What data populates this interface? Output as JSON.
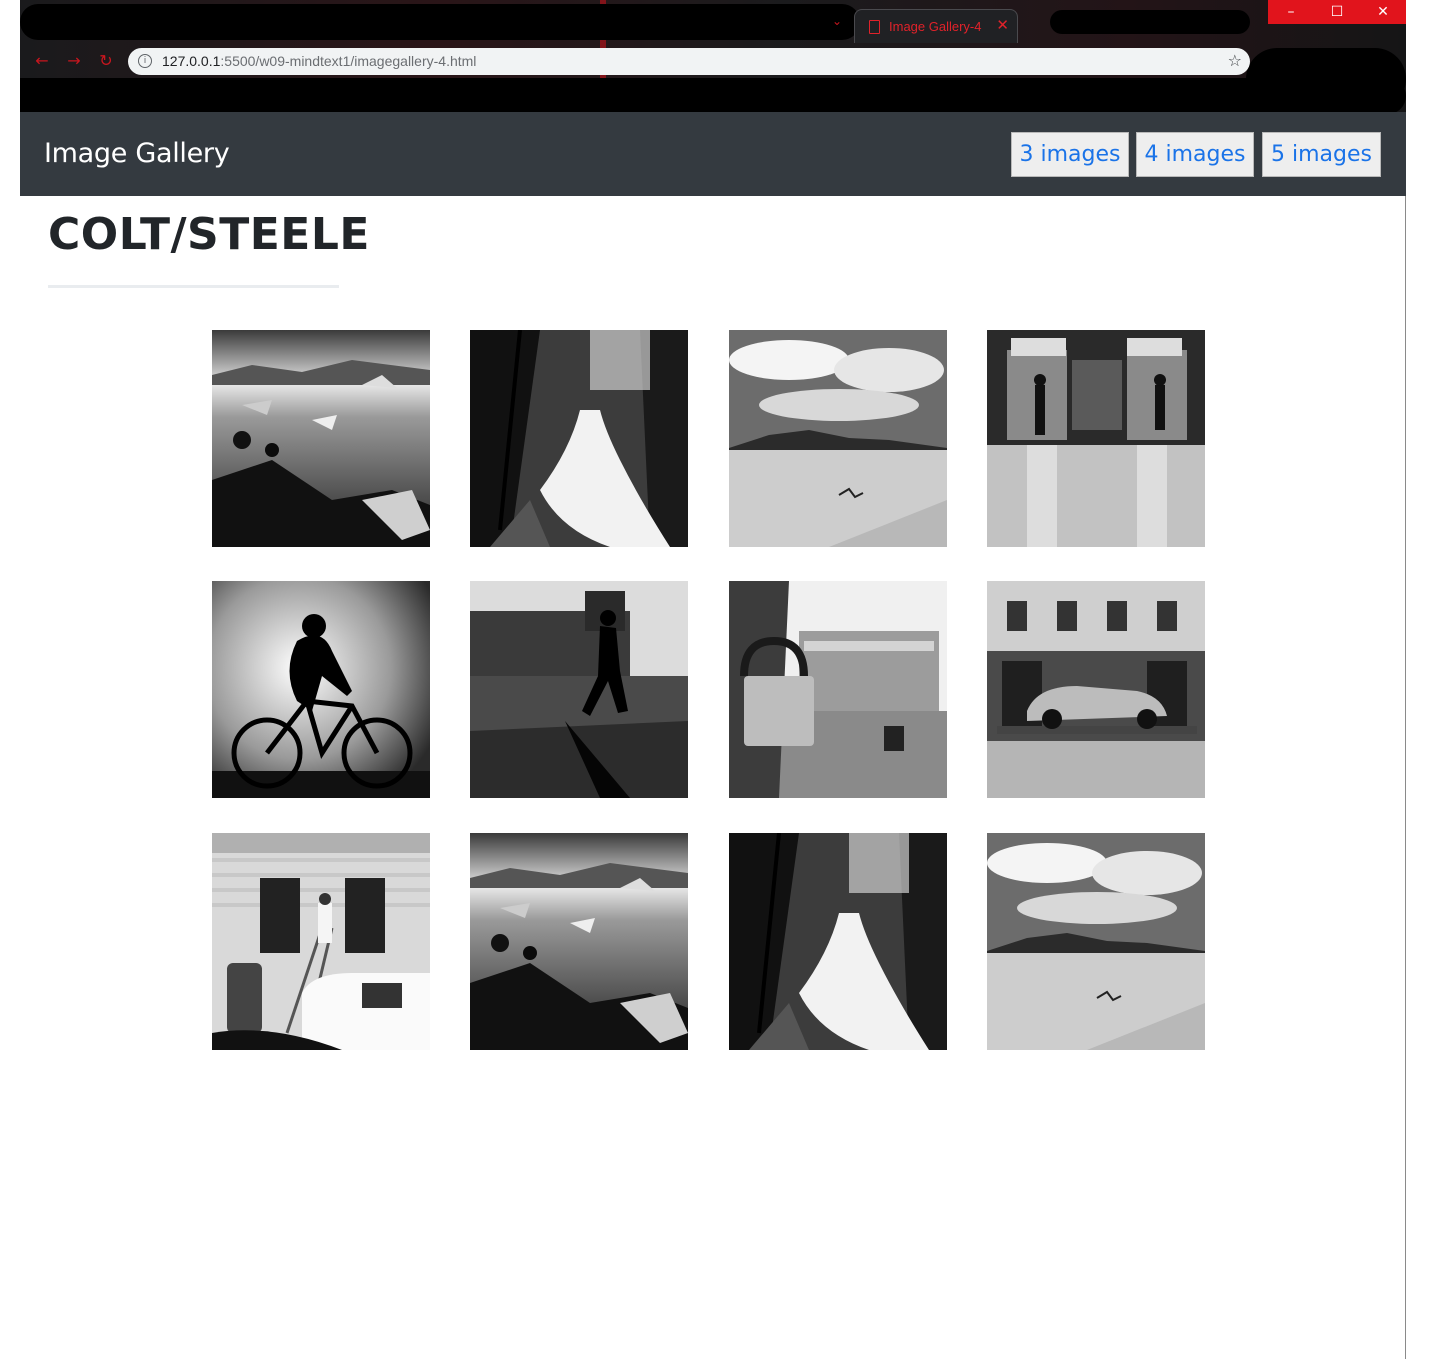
{
  "browser": {
    "tab_title": "Image Gallery-4",
    "tab_close_glyph": "✕",
    "url_host": "127.0.0.1",
    "url_rest": ":5500/w09-mindtext1/imagegallery-4.html",
    "window_controls": {
      "minimize": "–",
      "maximize": "☐",
      "close": "✕"
    },
    "nav_glyphs": {
      "back": "←",
      "forward": "→",
      "reload": "↻"
    },
    "icons": {
      "info": "info-icon",
      "bookmark": "star-icon",
      "tab": "document-icon"
    }
  },
  "navbar": {
    "brand": "Image Gallery",
    "buttons": [
      {
        "label": "3 images"
      },
      {
        "label": "4 images"
      },
      {
        "label": "5 images"
      }
    ]
  },
  "content": {
    "author": "COLT/STEELE"
  },
  "gallery": {
    "images": [
      {
        "subject": "glacier-lagoon"
      },
      {
        "subject": "forest-waterfall"
      },
      {
        "subject": "desert-dunes"
      },
      {
        "subject": "elevator-lobby"
      },
      {
        "subject": "cyclist-silhouette"
      },
      {
        "subject": "walker-silhouette"
      },
      {
        "subject": "padlock-square"
      },
      {
        "subject": "vintage-car-trailer"
      },
      {
        "subject": "painter-ladder"
      },
      {
        "subject": "glacier-lagoon"
      },
      {
        "subject": "forest-waterfall"
      },
      {
        "subject": "desert-dunes"
      }
    ]
  },
  "colors": {
    "navbar_bg": "#343a40",
    "button_text": "#1a73e8",
    "button_bg": "#eeeeee",
    "accent_red": "#e1141c",
    "heading": "#212529"
  }
}
